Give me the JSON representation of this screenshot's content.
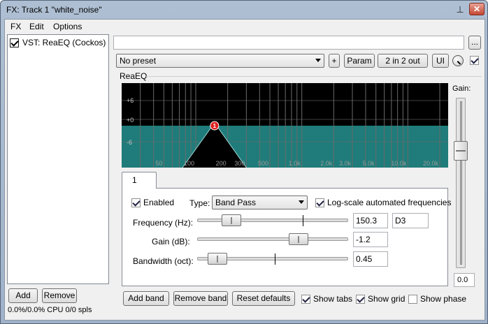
{
  "window": {
    "title": "FX: Track 1 \"white_noise\"",
    "close_label": "✕",
    "pin_glyph": "📌"
  },
  "menu": {
    "items": [
      "FX",
      "Edit",
      "Options"
    ]
  },
  "fx_chain": {
    "items": [
      {
        "label": "VST: ReaEQ (Cockos)",
        "enabled": true
      }
    ],
    "add_label": "Add",
    "remove_label": "Remove",
    "status": "0.0%/0.0% CPU 0/0 spls"
  },
  "plugin": {
    "top_button": "...",
    "preset": "No preset",
    "plus_label": "+",
    "param_label": "Param",
    "io_label": "2 in 2 out",
    "ui_label": "UI",
    "group_title": "ReaEQ"
  },
  "graph": {
    "db_labels": [
      "+6",
      "+0",
      "-6"
    ],
    "freq_labels": [
      "50",
      "100",
      "200",
      "300",
      "500",
      "1.0k",
      "2.0k",
      "3.0k",
      "5.0k",
      "10.0k",
      "20.0k"
    ],
    "band_marker": "1",
    "colors": {
      "background": "#000000",
      "fill": "#1f7c7a",
      "curve": "#000000",
      "grid": "#6a6a6a",
      "marker": "#e02020"
    }
  },
  "gain": {
    "label": "Gain:",
    "value": "0.0"
  },
  "band": {
    "tab_label": "1",
    "enabled_label": "Enabled",
    "enabled": true,
    "type_label": "Type:",
    "type_value": "Band Pass",
    "logscale_label": "Log-scale automated frequencies",
    "logscale": true,
    "frequency": {
      "label": "Frequency (Hz):",
      "value": "150.3",
      "note": "D3"
    },
    "gain": {
      "label": "Gain (dB):",
      "value": "-1.2"
    },
    "bandwidth": {
      "label": "Bandwidth (oct):",
      "value": "0.45"
    }
  },
  "footer": {
    "add_band": "Add band",
    "remove_band": "Remove band",
    "reset_defaults": "Reset defaults",
    "show_tabs": {
      "label": "Show tabs",
      "checked": true
    },
    "show_grid": {
      "label": "Show grid",
      "checked": true
    },
    "show_phase": {
      "label": "Show phase",
      "checked": false
    }
  }
}
